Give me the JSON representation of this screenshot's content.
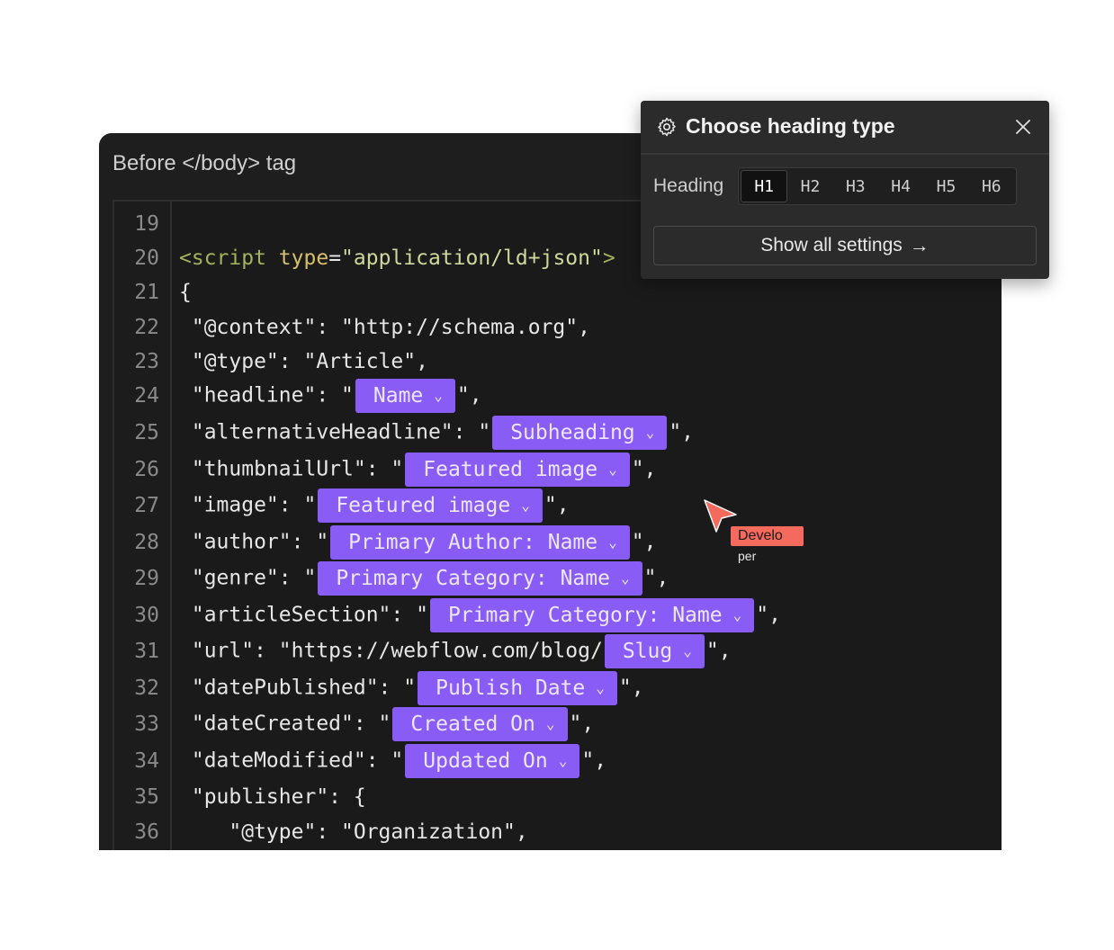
{
  "editor": {
    "title": "Before </body> tag",
    "line_numbers": [
      "19",
      "20",
      "21",
      "22",
      "23",
      "24",
      "25",
      "26",
      "27",
      "28",
      "29",
      "30",
      "31",
      "32",
      "33",
      "34",
      "35",
      "36"
    ],
    "lines": {
      "l20_tag_open": "<script",
      "l20_attr": "type",
      "l20_eq": "=",
      "l20_str": "\"application/ld+json\"",
      "l20_tag_close": ">",
      "l21": "{",
      "l22": " \"@context\": \"http://schema.org\",",
      "l23": " \"@type\": \"Article\",",
      "l24_pre": " \"headline\": \"",
      "l24_post": "\",",
      "l25_pre": " \"alternativeHeadline\": \"",
      "l25_post": "\",",
      "l26_pre": " \"thumbnailUrl\": \"",
      "l26_post": "\",",
      "l27_pre": " \"image\": \"",
      "l27_post": "\",",
      "l28_pre": " \"author\": \"",
      "l28_post": "\",",
      "l29_pre": " \"genre\": \"",
      "l29_post": "\",",
      "l30_pre": " \"articleSection\": \"",
      "l30_post": "\",",
      "l31_pre": " \"url\": \"https://webflow.com/blog/",
      "l31_post": "\",",
      "l32_pre": " \"datePublished\": \"",
      "l32_post": "\",",
      "l33_pre": " \"dateCreated\": \"",
      "l33_post": "\",",
      "l34_pre": " \"dateModified\": \"",
      "l34_post": "\",",
      "l35": " \"publisher\": {",
      "l36": "    \"@type\": \"Organization\","
    },
    "fields": {
      "name": "Name",
      "subheading": "Subheading",
      "featured_image_1": "Featured image",
      "featured_image_2": "Featured image",
      "primary_author": "Primary Author: Name",
      "primary_category_1": "Primary Category: Name",
      "primary_category_2": "Primary Category: Name",
      "slug": "Slug",
      "publish_date": "Publish Date",
      "created_on": "Created On",
      "updated_on": "Updated On"
    },
    "field_color": "#8a5cf6"
  },
  "popup": {
    "title": "Choose heading type",
    "heading_label": "Heading",
    "heading_options": [
      "H1",
      "H2",
      "H3",
      "H4",
      "H5",
      "H6"
    ],
    "selected": "H1",
    "show_all_label": "Show all settings",
    "icon": "gear-icon"
  },
  "cursor": {
    "label": "Develo",
    "sublabel": "per",
    "color": "#f46a5c"
  }
}
